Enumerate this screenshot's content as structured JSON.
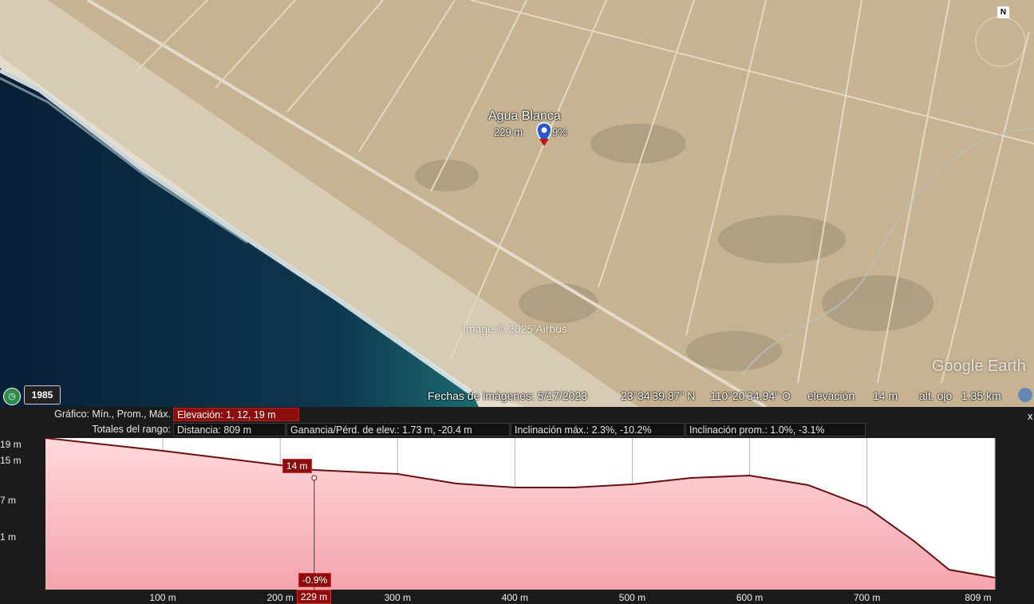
{
  "map": {
    "placemark": {
      "name": "Agua Blanca",
      "elevation": "229 m",
      "slope": "0.9%"
    },
    "watermark": "Image © 2025 Airbus",
    "logo": "Google Earth",
    "north_label": "N",
    "history_year": "1985",
    "status_bar": {
      "imagery_date": "Fechas de imágenes: 5/17/2023",
      "latitude": "23°34'39.87\" N",
      "longitude": "110°20'34.94\" O",
      "elevation_label": "elevación",
      "elevation_value": "14 m",
      "eye_alt": "alt. ojo   1.35 km"
    },
    "colors": {
      "ocean": "#0b2b45",
      "sand": "#c9b595",
      "placemark": "#2a58c9"
    }
  },
  "profile": {
    "graph_label": "Gráfico: Mín., Prom., Máx.",
    "graph_value": "Elevación: 1, 12, 19 m",
    "totals_label": "Totales del rango:",
    "distance": "Distancia: 809 m",
    "gain_loss": "Ganancia/Pérd. de elev.: 1.73 m, -20.4 m",
    "max_slope": "Inclinación máx.: 2.3%, -10.2%",
    "avg_slope": "Inclinación prom.: 1.0%, -3.1%",
    "close": "x",
    "cursor_elevation": "14 m",
    "cursor_slope": "-0.9%",
    "cursor_distance": "229 m",
    "y_ticks": [
      "19 m",
      "15 m",
      "7 m",
      "1 m"
    ],
    "x_ticks": [
      "100 m",
      "200 m",
      "300 m",
      "400 m",
      "500 m",
      "600 m",
      "700 m",
      "809 m"
    ],
    "corner_logo": "iad",
    "colors": {
      "line": "#6a0f12",
      "fill_top": "#ffd8dc",
      "fill_bottom": "#f4a5ad",
      "accent": "#8b0d0d"
    }
  },
  "chart_data": {
    "type": "area",
    "xlabel": "",
    "ylabel": "",
    "xlim": [
      0,
      809
    ],
    "ylim": [
      0,
      19
    ],
    "x": [
      0,
      100,
      200,
      229,
      300,
      350,
      400,
      450,
      500,
      550,
      600,
      650,
      700,
      740,
      770,
      809
    ],
    "y": [
      19,
      17.4,
      15.6,
      15,
      14.5,
      13.3,
      12.8,
      12.8,
      13.2,
      14.0,
      14.3,
      13.1,
      10.3,
      6.1,
      2.5,
      1.5
    ]
  }
}
